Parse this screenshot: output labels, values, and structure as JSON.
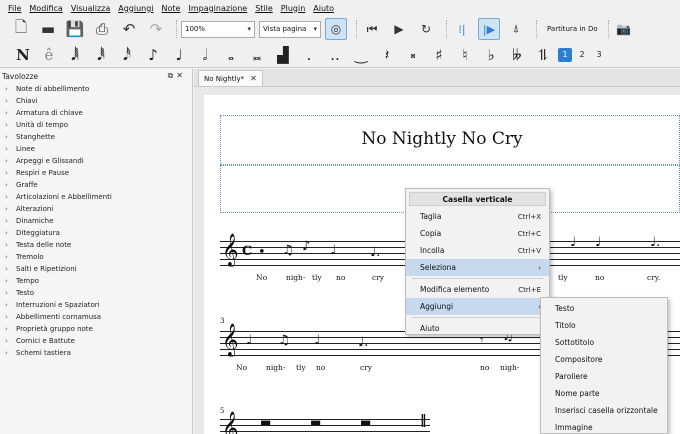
{
  "menubar": [
    "File",
    "Modifica",
    "Visualizza",
    "Aggiungi",
    "Note",
    "Impaginazione",
    "Stile",
    "Plugin",
    "Aiuto"
  ],
  "toolbar": {
    "zoom": "100%",
    "view_mode": "Vista pagina",
    "concert_pitch": "Partitura in Do"
  },
  "note_toolbar": {
    "voices": [
      "1",
      "2",
      "3"
    ]
  },
  "palettes": {
    "title": "Tavolozze",
    "items": [
      "Note di abbellimento",
      "Chiavi",
      "Armatura di chiave",
      "Unità di tempo",
      "Stanghette",
      "Linee",
      "Arpeggi e Glissandi",
      "Respiri e Pause",
      "Graffe",
      "Articolazioni e Abbellimenti",
      "Alterazioni",
      "Dinamiche",
      "Diteggiatura",
      "Testa delle note",
      "Tremolo",
      "Salti e Ripetizioni",
      "Tempo",
      "Testo",
      "Interruzioni e Spaziatori",
      "Abbellimenti cornamusa",
      "Proprietà gruppo note",
      "Cornici e Battute",
      "Schemi tastiera"
    ]
  },
  "score": {
    "tab": "No Nightly*",
    "title": "No Nightly No Cry",
    "system1_lyrics": [
      "No",
      "nigh-",
      "tly",
      "no",
      "cry",
      "tly",
      "no",
      "cry."
    ],
    "system2_number": "3",
    "system2_lyrics": [
      "No",
      "nigh-",
      "tly",
      "no",
      "cry",
      "no",
      "nigh-"
    ],
    "system3_number": "5"
  },
  "context_menu": {
    "title": "Casella verticale",
    "items": [
      {
        "label": "Taglia",
        "shortcut": "Ctrl+X"
      },
      {
        "label": "Copia",
        "shortcut": "Ctrl+C"
      },
      {
        "label": "Incolla",
        "shortcut": "Ctrl+V"
      },
      {
        "label": "Seleziona",
        "shortcut": "›"
      },
      {
        "label": "Modifica elemento",
        "shortcut": "Ctrl+E"
      },
      {
        "label": "Aggiungi",
        "shortcut": "›"
      },
      {
        "label": "Aiuto",
        "shortcut": ""
      }
    ]
  },
  "submenu": {
    "items": [
      "Testo",
      "Titolo",
      "Sottotitolo",
      "Compositore",
      "Paroliere",
      "Nome parte",
      "Inserisci casella orizzontale",
      "Immagine"
    ]
  }
}
